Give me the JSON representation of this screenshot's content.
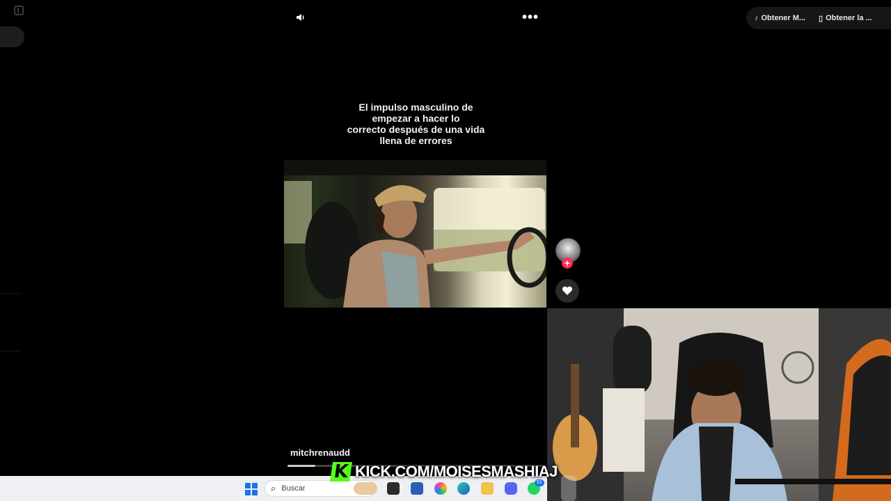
{
  "top_actions": {
    "obtain_music": "Obtener M...",
    "obtain_app": "Obtener la ..."
  },
  "video": {
    "caption_lines": [
      "El impulso masculino de",
      "empezar a hacer lo",
      "correcto después de una vida",
      "llena de errores"
    ],
    "username": "mitchrenaudd",
    "progress": 0.11
  },
  "follow_symbol": "+",
  "taskbar": {
    "search_placeholder": "Buscar",
    "notification_count": "51"
  },
  "overlay": {
    "kick_letter": "K",
    "kick_url": "KICK.COM/MOISESMASHIAJ"
  },
  "colors": {
    "follow": "#fe2c55",
    "kick": "#53fc18",
    "windows_blue": "#1a73e8"
  }
}
